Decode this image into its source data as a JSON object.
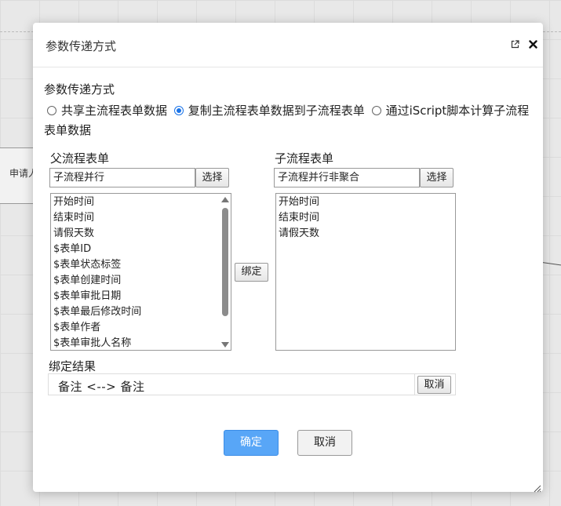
{
  "background": {
    "node_label": "申请人"
  },
  "dialog": {
    "title": "参数传递方式",
    "section_label": "参数传递方式",
    "radio_options": [
      {
        "label": "共享主流程表单数据",
        "checked": false
      },
      {
        "label": "复制主流程表单数据到子流程表单",
        "checked": true
      },
      {
        "label": "通过iScript脚本计算子流程表单数据",
        "checked": false
      }
    ],
    "parent": {
      "title": "父流程表单",
      "form_value": "子流程并行",
      "select_label": "选择",
      "fields": [
        "开始时间",
        "结束时间",
        "请假天数",
        "$表单ID",
        "$表单状态标签",
        "$表单创建时间",
        "$表单审批日期",
        "$表单最后修改时间",
        "$表单作者",
        "$表单审批人名称"
      ]
    },
    "bind_label": "绑定",
    "child": {
      "title": "子流程表单",
      "form_value": "子流程并行非聚合",
      "select_label": "选择",
      "fields": [
        "开始时间",
        "结束时间",
        "请假天数"
      ]
    },
    "result": {
      "label": "绑定结果",
      "value": "备注 <--> 备注",
      "cancel_label": "取消"
    },
    "confirm_label": "确定",
    "cancel_label": "取消"
  },
  "colors": {
    "primary": "#58a6f7",
    "radio_checked": "#1a73e8"
  },
  "icons": [
    "expand-icon",
    "close-icon",
    "resize-grip-icon",
    "scroll-up-icon",
    "scroll-down-icon"
  ]
}
